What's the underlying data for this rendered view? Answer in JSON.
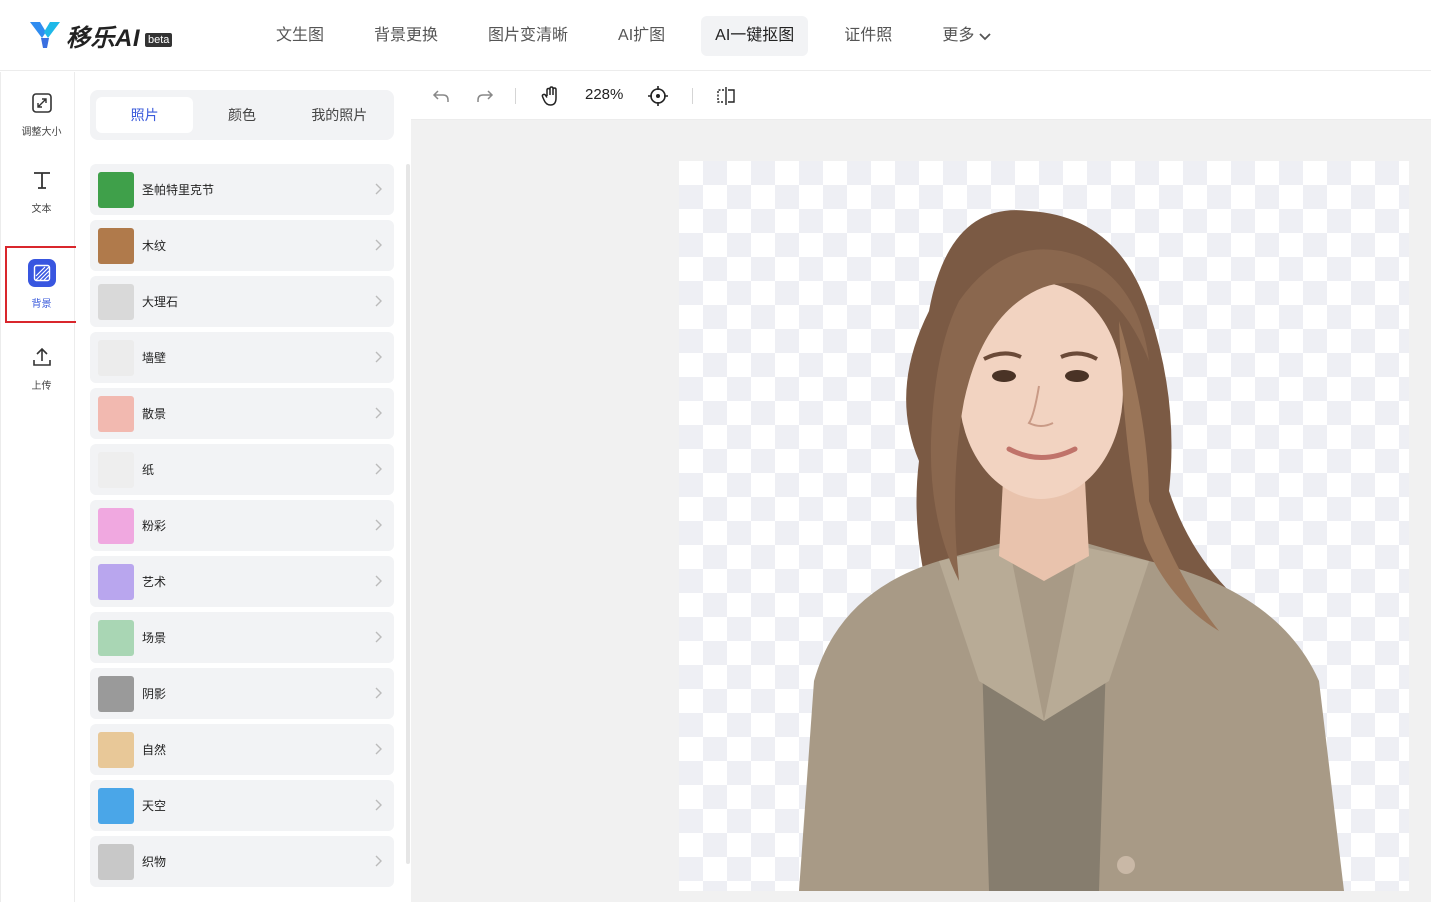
{
  "app": {
    "logo_text": "移乐AI",
    "badge": "beta"
  },
  "nav": {
    "items": [
      {
        "label": "文生图"
      },
      {
        "label": "背景更换"
      },
      {
        "label": "图片变清晰"
      },
      {
        "label": "AI扩图"
      },
      {
        "label": "AI一键抠图",
        "active": true
      },
      {
        "label": "证件照"
      }
    ],
    "more_label": "更多"
  },
  "toolbar": {
    "items": [
      {
        "label": "调整大小",
        "icon": "resize-icon"
      },
      {
        "label": "文本",
        "icon": "text-icon"
      },
      {
        "label": "背景",
        "icon": "background-icon",
        "active": true
      },
      {
        "label": "上传",
        "icon": "upload-icon"
      }
    ]
  },
  "panel": {
    "tabs": [
      {
        "label": "照片",
        "active": true
      },
      {
        "label": "颜色"
      },
      {
        "label": "我的照片"
      }
    ],
    "categories": [
      {
        "label": "圣帕特里克节",
        "color": "#3fa04a"
      },
      {
        "label": "木纹",
        "color": "#b07a4b"
      },
      {
        "label": "大理石",
        "color": "#d9d9d9"
      },
      {
        "label": "墙壁",
        "color": "#ececec"
      },
      {
        "label": "散景",
        "color": "#f2b9b0"
      },
      {
        "label": "纸",
        "color": "#eeeeee"
      },
      {
        "label": "粉彩",
        "color": "#f0a8e0"
      },
      {
        "label": "艺术",
        "color": "#b9a6ee"
      },
      {
        "label": "场景",
        "color": "#a9d6b4"
      },
      {
        "label": "阴影",
        "color": "#9a9a9a"
      },
      {
        "label": "自然",
        "color": "#e8c898"
      },
      {
        "label": "天空",
        "color": "#4aa6e8"
      },
      {
        "label": "织物",
        "color": "#c8c8c8"
      }
    ]
  },
  "canvas": {
    "zoom": "228%",
    "icons": [
      "undo-icon",
      "redo-icon",
      "hand-icon",
      "crosshair-icon",
      "flip-icon"
    ]
  }
}
